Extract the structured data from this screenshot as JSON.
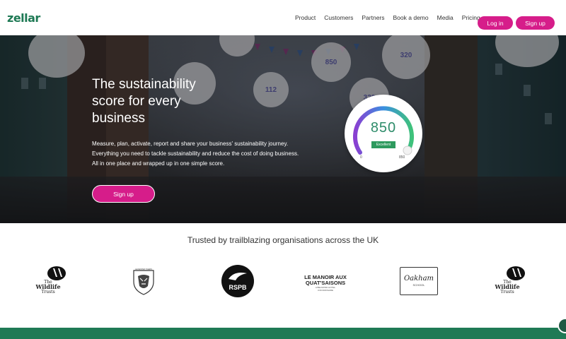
{
  "header": {
    "logo": "zellar",
    "nav": [
      "Product",
      "Customers",
      "Partners",
      "Book a demo",
      "Media",
      "Pricing"
    ],
    "login_label": "Log in",
    "signup_label": "Sign up"
  },
  "hero": {
    "title_lines": [
      "The sustainability",
      "score for every",
      "business"
    ],
    "text_lines": [
      "Measure, plan, activate, report and share your business' sustainability journey.",
      "Everything you need to tackle sustainability and reduce the cost of doing business.",
      "All in one place and wrapped up in one simple score."
    ],
    "signup_label": "Sign up",
    "bubbles": [
      "320",
      "850",
      "112",
      "320"
    ],
    "gauge": {
      "score": "850",
      "badge": "Excellent",
      "min": "0",
      "max": "850"
    }
  },
  "trusted": {
    "heading": "Trusted by trailblazing organisations across the UK",
    "logos": {
      "wildlife_1": [
        "The",
        "Wildlife",
        "Trusts"
      ],
      "tigers": "LEICESTER TIGERS",
      "rspb": "RSPB",
      "manoir": [
        "LE MANOIR AUX",
        "QUAT'SAISONS",
        "A BELMOND HOTEL",
        "OXFORDSHIRE"
      ],
      "oakham": [
        "Oakham",
        "SCHOOL"
      ],
      "wildlife_2": [
        "The",
        "Wildlife",
        "Trusts"
      ]
    }
  },
  "colors": {
    "brand": "#1f7a55",
    "accent": "#d61d8a"
  }
}
